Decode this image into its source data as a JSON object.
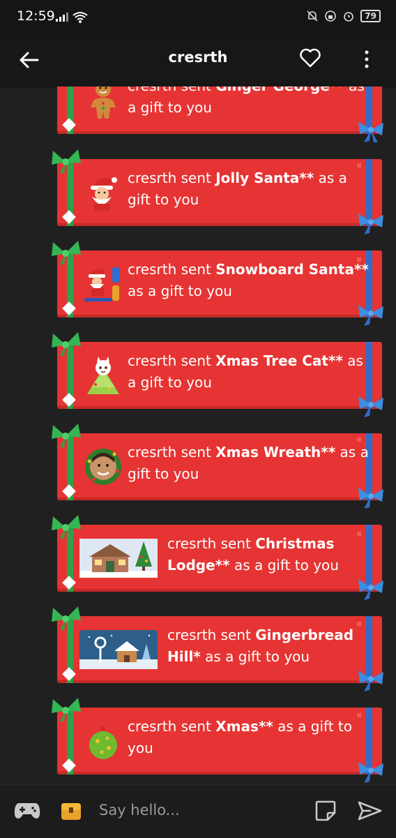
{
  "status_bar": {
    "time": "12:59",
    "battery": "79"
  },
  "header": {
    "title": "cresrth"
  },
  "gifts": [
    {
      "sender": "cresrth sent ",
      "item": "Ginger George**",
      "suffix": " as a gift to you",
      "icon": "gingerbread-man"
    },
    {
      "sender": "cresrth sent ",
      "item": "Jolly Santa**",
      "suffix": " as a gift to you",
      "icon": "santa"
    },
    {
      "sender": "cresrth sent ",
      "item": "Snowboard Santa**",
      "suffix": " as a gift to you",
      "icon": "snowboard-santa"
    },
    {
      "sender": "cresrth sent ",
      "item": "Xmas Tree Cat**",
      "suffix": " as a gift to you",
      "icon": "tree-cat"
    },
    {
      "sender": "cresrth sent ",
      "item": "Xmas Wreath**",
      "suffix": " as a gift to you",
      "icon": "wreath-avatar"
    },
    {
      "sender": "cresrth sent ",
      "item": "Christmas Lodge**",
      "suffix": " as a gift to you",
      "icon": "lodge-scene"
    },
    {
      "sender": "cresrth sent ",
      "item": "Gingerbread Hill*",
      "suffix": " as a gift to you",
      "icon": "gingerbread-hill-scene"
    },
    {
      "sender": "cresrth sent ",
      "item": "Xmas**",
      "suffix": " as a gift to you",
      "icon": "ornament"
    }
  ],
  "composer": {
    "placeholder": "Say hello..."
  },
  "colors": {
    "gift_red": "#e53433",
    "ribbon_green": "#2ea24a",
    "ribbon_blue": "#2f6fc8",
    "background": "#202020"
  }
}
